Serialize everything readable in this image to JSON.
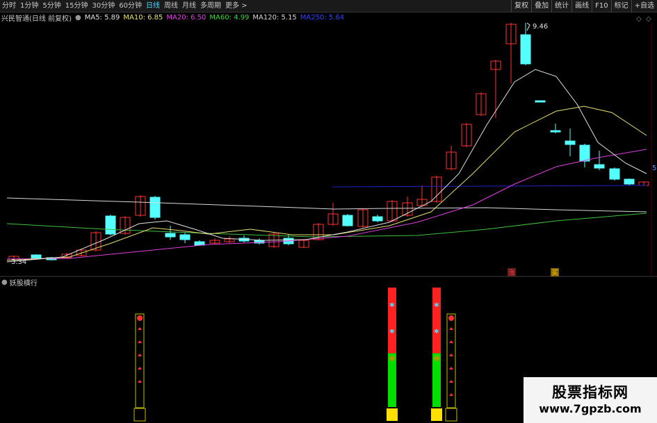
{
  "toolbar": {
    "tabs": [
      {
        "label": "分时"
      },
      {
        "label": "1分钟"
      },
      {
        "label": "5分钟"
      },
      {
        "label": "15分钟"
      },
      {
        "label": "30分钟"
      },
      {
        "label": "60分钟"
      },
      {
        "label": "日线",
        "active": true
      },
      {
        "label": "周线"
      },
      {
        "label": "月线"
      },
      {
        "label": "多周期"
      },
      {
        "label": "更多 >"
      }
    ],
    "right_tools": [
      {
        "label": "复权"
      },
      {
        "label": "叠加"
      },
      {
        "label": "统计"
      },
      {
        "label": "画线"
      },
      {
        "label": "F10"
      },
      {
        "label": "标记"
      },
      {
        "label": "+自选"
      }
    ]
  },
  "header": {
    "stock_title": "兴民智通(日线 前复权)",
    "ma": [
      {
        "label": "MA5: 5.89",
        "color": "#e0e0e0"
      },
      {
        "label": "MA10: 6.85",
        "color": "#e8e070"
      },
      {
        "label": "MA20: 6.50",
        "color": "#e040e0"
      },
      {
        "label": "MA60: 4.99",
        "color": "#40d040"
      },
      {
        "label": "MA120: 5.15",
        "color": "#d8d8d8"
      },
      {
        "label": "MA250: 5.64",
        "color": "#3040ff"
      }
    ]
  },
  "price_panel": {
    "high_label": "9.46",
    "low_label": "3.34",
    "right_tag": "5",
    "marker_zhang": "涨",
    "marker_buy": "买",
    "icons": {
      "title_icon": "circle-icon",
      "diamond": "diamond-icon",
      "pin": "pin-icon"
    }
  },
  "indicator_panel": {
    "title": "妖股横行",
    "columns": [
      {
        "type": "arrows",
        "arrow_count": 5
      },
      {
        "type": "bull",
        "red_fraction": 0.55,
        "green_fraction": 0.45
      },
      {
        "type": "bull",
        "red_fraction": 0.55,
        "green_fraction": 0.45
      },
      {
        "type": "arrows",
        "arrow_count": 6
      }
    ]
  },
  "watermark": {
    "line1": "股票指标网",
    "line2": "www.7gpzb.com"
  },
  "colors": {
    "up": "#ff3232",
    "down": "#54ffff",
    "ma250": "#2020d0",
    "green": "#00e000",
    "yellow": "#ffe000"
  }
}
